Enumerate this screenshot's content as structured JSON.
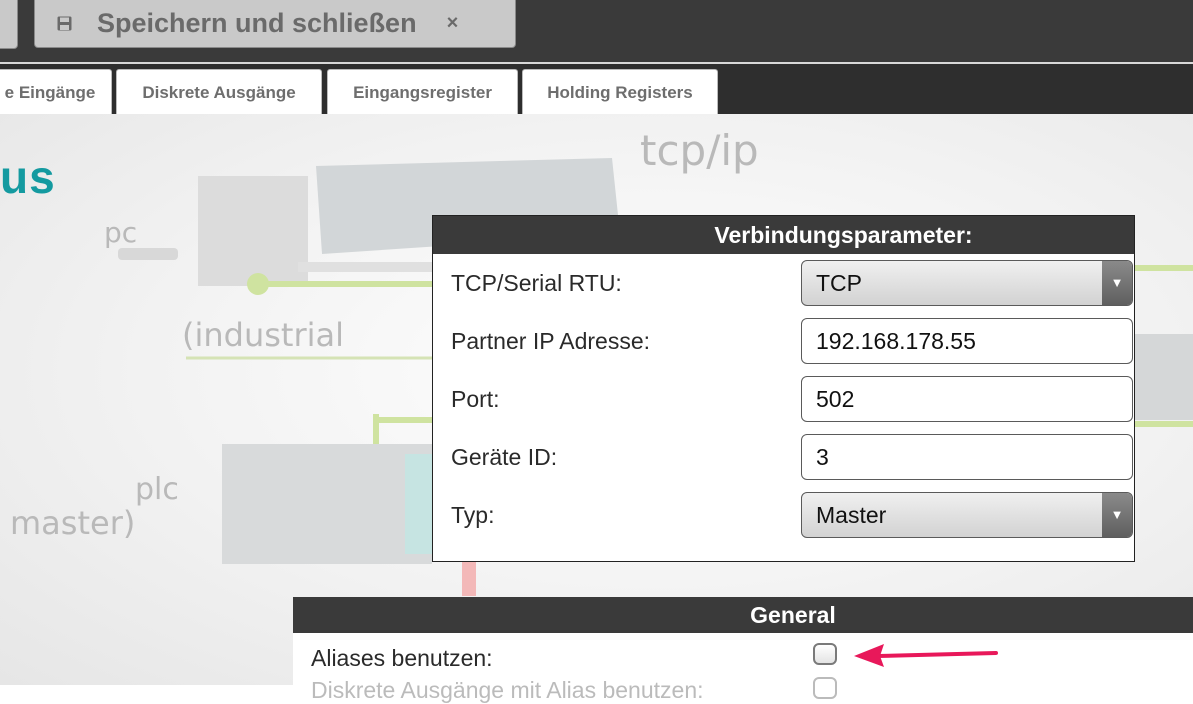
{
  "toolbar": {
    "save_close_label": "Speichern und schließen",
    "close_glyph": "×",
    "save_icon": "floppy-disk-icon"
  },
  "tabs": [
    {
      "label": "e Eingänge"
    },
    {
      "label": "Diskrete Ausgänge"
    },
    {
      "label": "Eingangsregister"
    },
    {
      "label": "Holding Registers"
    }
  ],
  "page": {
    "title_partial": "us"
  },
  "background_diagram": {
    "labels": {
      "tcpip": "tcp/ip",
      "pc": "pc",
      "industrial": "(industrial",
      "plc": "plc",
      "master": "master)"
    },
    "line_color": "#c8df8a"
  },
  "connection": {
    "header": "Verbindungsparameter:",
    "fields": [
      {
        "label": "TCP/Serial RTU:",
        "value": "TCP",
        "type": "select"
      },
      {
        "label": "Partner IP Adresse:",
        "value": "192.168.178.55",
        "type": "text"
      },
      {
        "label": "Port:",
        "value": "502",
        "type": "text"
      },
      {
        "label": "Geräte ID:",
        "value": "3",
        "type": "text"
      },
      {
        "label": "Typ:",
        "value": "Master",
        "type": "select"
      }
    ],
    "dropdown_glyph": "▼"
  },
  "general": {
    "header": "General",
    "aliases_label": "Aliases benutzen:",
    "aliases_checked": false,
    "next_row_label": "Diskrete Ausgänge mit Alias benutzen:"
  },
  "annotation": {
    "arrow_color": "#e8185a"
  },
  "colors": {
    "toolbar_bg": "#3a3a3a",
    "accent_title": "#149aa0",
    "panel_header_bg": "#3a3a3a"
  }
}
